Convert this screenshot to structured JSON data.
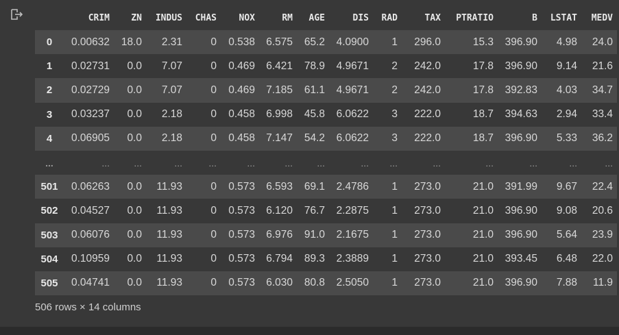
{
  "table": {
    "columns": [
      "",
      "CRIM",
      "ZN",
      "INDUS",
      "CHAS",
      "NOX",
      "RM",
      "AGE",
      "DIS",
      "RAD",
      "TAX",
      "PTRATIO",
      "B",
      "LSTAT",
      "MEDV"
    ],
    "rows": [
      [
        "0",
        "0.00632",
        "18.0",
        "2.31",
        "0",
        "0.538",
        "6.575",
        "65.2",
        "4.0900",
        "1",
        "296.0",
        "15.3",
        "396.90",
        "4.98",
        "24.0"
      ],
      [
        "1",
        "0.02731",
        "0.0",
        "7.07",
        "0",
        "0.469",
        "6.421",
        "78.9",
        "4.9671",
        "2",
        "242.0",
        "17.8",
        "396.90",
        "9.14",
        "21.6"
      ],
      [
        "2",
        "0.02729",
        "0.0",
        "7.07",
        "0",
        "0.469",
        "7.185",
        "61.1",
        "4.9671",
        "2",
        "242.0",
        "17.8",
        "392.83",
        "4.03",
        "34.7"
      ],
      [
        "3",
        "0.03237",
        "0.0",
        "2.18",
        "0",
        "0.458",
        "6.998",
        "45.8",
        "6.0622",
        "3",
        "222.0",
        "18.7",
        "394.63",
        "2.94",
        "33.4"
      ],
      [
        "4",
        "0.06905",
        "0.0",
        "2.18",
        "0",
        "0.458",
        "7.147",
        "54.2",
        "6.0622",
        "3",
        "222.0",
        "18.7",
        "396.90",
        "5.33",
        "36.2"
      ],
      [
        "...",
        "...",
        "...",
        "...",
        "...",
        "...",
        "...",
        "...",
        "...",
        "...",
        "...",
        "...",
        "...",
        "...",
        "..."
      ],
      [
        "501",
        "0.06263",
        "0.0",
        "11.93",
        "0",
        "0.573",
        "6.593",
        "69.1",
        "2.4786",
        "1",
        "273.0",
        "21.0",
        "391.99",
        "9.67",
        "22.4"
      ],
      [
        "502",
        "0.04527",
        "0.0",
        "11.93",
        "0",
        "0.573",
        "6.120",
        "76.7",
        "2.2875",
        "1",
        "273.0",
        "21.0",
        "396.90",
        "9.08",
        "20.6"
      ],
      [
        "503",
        "0.06076",
        "0.0",
        "11.93",
        "0",
        "0.573",
        "6.976",
        "91.0",
        "2.1675",
        "1",
        "273.0",
        "21.0",
        "396.90",
        "5.64",
        "23.9"
      ],
      [
        "504",
        "0.10959",
        "0.0",
        "11.93",
        "0",
        "0.573",
        "6.794",
        "89.3",
        "2.3889",
        "1",
        "273.0",
        "21.0",
        "393.45",
        "6.48",
        "22.0"
      ],
      [
        "505",
        "0.04741",
        "0.0",
        "11.93",
        "0",
        "0.573",
        "6.030",
        "80.8",
        "2.5050",
        "1",
        "273.0",
        "21.0",
        "396.90",
        "7.88",
        "11.9"
      ]
    ]
  },
  "footer": "506 rows × 14 columns",
  "icons": {
    "output": "output-redirect-icon"
  },
  "colors": {
    "background": "#383838",
    "row_alt": "#4a4a4a",
    "text": "#dcdcdc"
  }
}
